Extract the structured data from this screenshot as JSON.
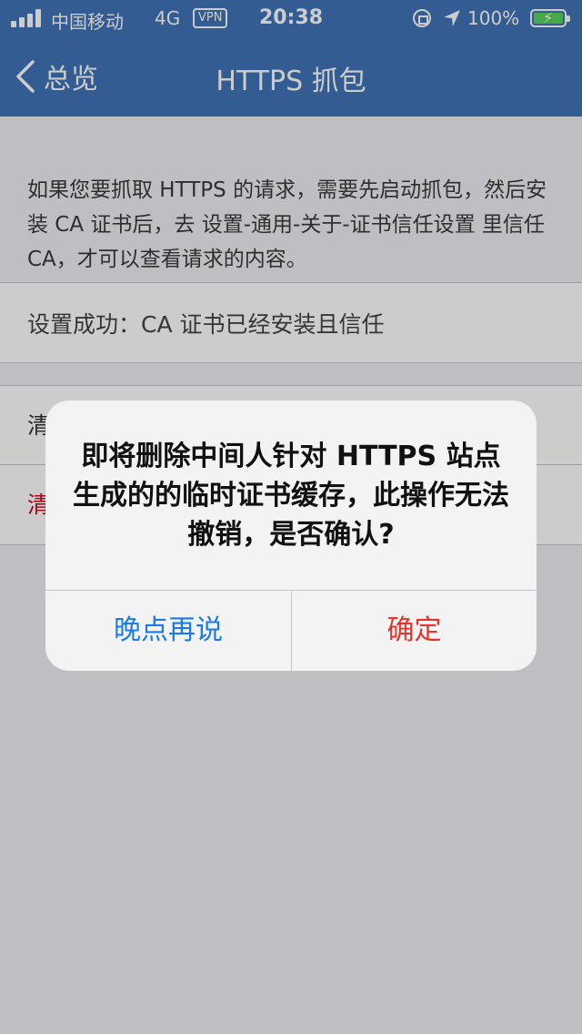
{
  "status_bar": {
    "carrier": "中国移动",
    "network": "4G",
    "vpn": "VPN",
    "time": "20:38",
    "battery": "100%"
  },
  "nav": {
    "back_label": "总览",
    "title": "HTTPS 抓包"
  },
  "content": {
    "intro": "如果您要抓取 HTTPS 的请求，需要先启动抓包，然后安装 CA 证书后，去 设置-通用-关于-证书信任设置 里信任 CA，才可以查看请求的内容。",
    "status": "设置成功：CA 证书已经安装且信任",
    "clear_item_1": "清",
    "clear_item_2": "清"
  },
  "alert": {
    "message": "即将删除中间人针对 HTTPS 站点生成的的临时证书缓存，此操作无法撤销，是否确认?",
    "cancel_label": "晚点再说",
    "confirm_label": "确定"
  },
  "colors": {
    "nav_background": "#3f74b7",
    "cancel_blue": "#1a7ae8",
    "confirm_red": "#e8322b",
    "destructive_red": "#d0021b",
    "battery_green": "#5bd45b"
  }
}
